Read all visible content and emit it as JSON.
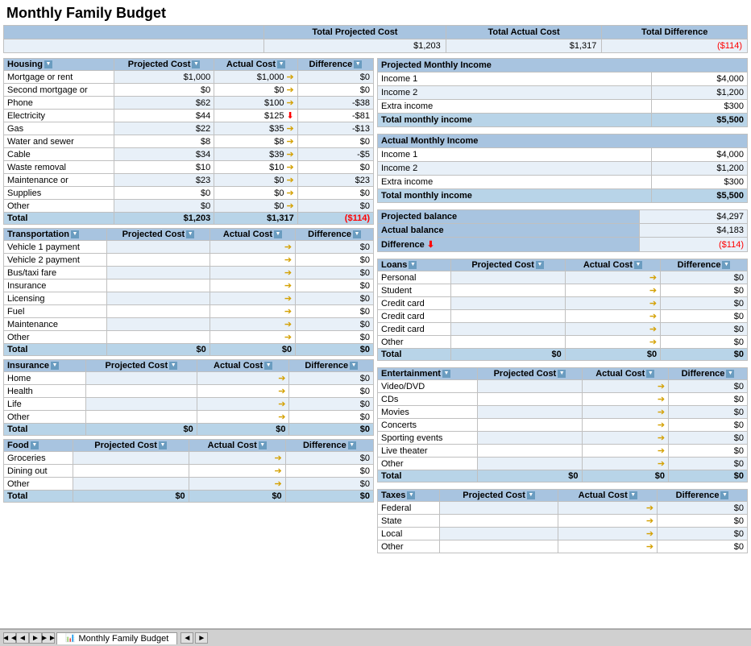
{
  "title": "Monthly Family Budget",
  "summary": {
    "headers": [
      "",
      "Total Projected Cost",
      "Total Actual Cost",
      "Total Difference"
    ],
    "values": [
      "",
      "$1,203",
      "$1,317",
      "($114)"
    ]
  },
  "projected_income": {
    "title": "Projected Monthly Income",
    "rows": [
      {
        "label": "Income 1",
        "value": "$4,000"
      },
      {
        "label": "Income 2",
        "value": "$1,200"
      },
      {
        "label": "Extra income",
        "value": "$300"
      },
      {
        "label": "Total monthly income",
        "value": "$5,500",
        "total": true
      }
    ]
  },
  "actual_income": {
    "title": "Actual Monthly Income",
    "rows": [
      {
        "label": "Income 1",
        "value": "$4,000"
      },
      {
        "label": "Income 2",
        "value": "$1,200"
      },
      {
        "label": "Extra income",
        "value": "$300"
      },
      {
        "label": "Total monthly income",
        "value": "$5,500",
        "total": true
      }
    ]
  },
  "balance": {
    "projected_balance": {
      "label": "Projected balance",
      "value": "$4,297"
    },
    "actual_balance": {
      "label": "Actual balance",
      "value": "$4,183"
    },
    "difference": {
      "label": "Difference",
      "value": "($114)"
    }
  },
  "housing": {
    "title": "Housing",
    "headers": [
      "Housing",
      "Projected Cost",
      "Actual Cost",
      "Difference"
    ],
    "rows": [
      {
        "label": "Mortgage or rent",
        "projected": "$1,000",
        "actual": "$1,000",
        "diff": "$0",
        "arrow": "orange"
      },
      {
        "label": "Second mortgage or",
        "projected": "$0",
        "actual": "$0",
        "diff": "$0",
        "arrow": "orange"
      },
      {
        "label": "Phone",
        "projected": "$62",
        "actual": "$100",
        "diff": "-$38",
        "arrow": "orange"
      },
      {
        "label": "Electricity",
        "projected": "$44",
        "actual": "$125",
        "diff": "-$81",
        "arrow": "red"
      },
      {
        "label": "Gas",
        "projected": "$22",
        "actual": "$35",
        "diff": "-$13",
        "arrow": "orange"
      },
      {
        "label": "Water and sewer",
        "projected": "$8",
        "actual": "$8",
        "diff": "$0",
        "arrow": "orange"
      },
      {
        "label": "Cable",
        "projected": "$34",
        "actual": "$39",
        "diff": "-$5",
        "arrow": "orange"
      },
      {
        "label": "Waste removal",
        "projected": "$10",
        "actual": "$10",
        "diff": "$0",
        "arrow": "orange"
      },
      {
        "label": "Maintenance or",
        "projected": "$23",
        "actual": "$0",
        "diff": "$23",
        "arrow": "orange"
      },
      {
        "label": "Supplies",
        "projected": "$0",
        "actual": "$0",
        "diff": "$0",
        "arrow": "orange"
      },
      {
        "label": "Other",
        "projected": "$0",
        "actual": "$0",
        "diff": "$0",
        "arrow": "orange"
      }
    ],
    "total": {
      "label": "Total",
      "projected": "$1,203",
      "actual": "$1,317",
      "diff": "($114)"
    }
  },
  "transportation": {
    "title": "Transportation",
    "headers": [
      "Transportation",
      "Projected Cost",
      "Actual Cost",
      "Difference"
    ],
    "rows": [
      {
        "label": "Vehicle 1 payment",
        "projected": "",
        "actual": "",
        "diff": "$0"
      },
      {
        "label": "Vehicle 2 payment",
        "projected": "",
        "actual": "",
        "diff": "$0"
      },
      {
        "label": "Bus/taxi fare",
        "projected": "",
        "actual": "",
        "diff": "$0"
      },
      {
        "label": "Insurance",
        "projected": "",
        "actual": "",
        "diff": "$0"
      },
      {
        "label": "Licensing",
        "projected": "",
        "actual": "",
        "diff": "$0"
      },
      {
        "label": "Fuel",
        "projected": "",
        "actual": "",
        "diff": "$0"
      },
      {
        "label": "Maintenance",
        "projected": "",
        "actual": "",
        "diff": "$0"
      },
      {
        "label": "Other",
        "projected": "",
        "actual": "",
        "diff": "$0"
      }
    ],
    "total": {
      "label": "Total",
      "projected": "$0",
      "actual": "$0",
      "diff": "$0"
    }
  },
  "insurance": {
    "title": "Insurance",
    "headers": [
      "Insurance",
      "Projected Cost",
      "Actual Cost",
      "Difference"
    ],
    "rows": [
      {
        "label": "Home",
        "projected": "",
        "actual": "",
        "diff": "$0"
      },
      {
        "label": "Health",
        "projected": "",
        "actual": "",
        "diff": "$0"
      },
      {
        "label": "Life",
        "projected": "",
        "actual": "",
        "diff": "$0"
      },
      {
        "label": "Other",
        "projected": "",
        "actual": "",
        "diff": "$0"
      }
    ],
    "total": {
      "label": "Total",
      "projected": "$0",
      "actual": "$0",
      "diff": "$0"
    }
  },
  "food": {
    "title": "Food",
    "headers": [
      "Food",
      "Projected Cost",
      "Actual Cost",
      "Difference"
    ],
    "rows": [
      {
        "label": "Groceries",
        "projected": "",
        "actual": "",
        "diff": "$0"
      },
      {
        "label": "Dining out",
        "projected": "",
        "actual": "",
        "diff": "$0"
      },
      {
        "label": "Other",
        "projected": "",
        "actual": "",
        "diff": "$0"
      }
    ],
    "total": {
      "label": "Total",
      "projected": "$0",
      "actual": "$0",
      "diff": "$0"
    }
  },
  "loans": {
    "title": "Loans",
    "headers": [
      "Loans",
      "Projected Cost",
      "Actual Cost",
      "Difference"
    ],
    "rows": [
      {
        "label": "Personal",
        "projected": "",
        "actual": "",
        "diff": "$0"
      },
      {
        "label": "Student",
        "projected": "",
        "actual": "",
        "diff": "$0"
      },
      {
        "label": "Credit card",
        "projected": "",
        "actual": "",
        "diff": "$0"
      },
      {
        "label": "Credit card",
        "projected": "",
        "actual": "",
        "diff": "$0"
      },
      {
        "label": "Credit card",
        "projected": "",
        "actual": "",
        "diff": "$0"
      },
      {
        "label": "Other",
        "projected": "",
        "actual": "",
        "diff": "$0"
      }
    ],
    "total": {
      "label": "Total",
      "projected": "$0",
      "actual": "$0",
      "diff": "$0"
    }
  },
  "entertainment": {
    "title": "Entertainment",
    "headers": [
      "Entertainment",
      "Projected Cost",
      "Actual Cost",
      "Difference"
    ],
    "rows": [
      {
        "label": "Video/DVD",
        "projected": "",
        "actual": "",
        "diff": "$0"
      },
      {
        "label": "CDs",
        "projected": "",
        "actual": "",
        "diff": "$0"
      },
      {
        "label": "Movies",
        "projected": "",
        "actual": "",
        "diff": "$0"
      },
      {
        "label": "Concerts",
        "projected": "",
        "actual": "",
        "diff": "$0"
      },
      {
        "label": "Sporting events",
        "projected": "",
        "actual": "",
        "diff": "$0"
      },
      {
        "label": "Live theater",
        "projected": "",
        "actual": "",
        "diff": "$0"
      },
      {
        "label": "Other",
        "projected": "",
        "actual": "",
        "diff": "$0"
      }
    ],
    "total": {
      "label": "Total",
      "projected": "$0",
      "actual": "$0",
      "diff": "$0"
    }
  },
  "taxes": {
    "title": "Taxes",
    "headers": [
      "Taxes",
      "Projected Cost",
      "Actual Cost",
      "Difference"
    ],
    "rows": [
      {
        "label": "Federal",
        "projected": "",
        "actual": "",
        "diff": "$0"
      },
      {
        "label": "State",
        "projected": "",
        "actual": "",
        "diff": "$0"
      },
      {
        "label": "Local",
        "projected": "",
        "actual": "",
        "diff": "$0"
      },
      {
        "label": "Other",
        "projected": "",
        "actual": "",
        "diff": "$0"
      }
    ]
  },
  "tab": {
    "label": "Monthly Family Budget",
    "nav_buttons": [
      "◄◄",
      "◄",
      "►",
      "►►"
    ]
  }
}
